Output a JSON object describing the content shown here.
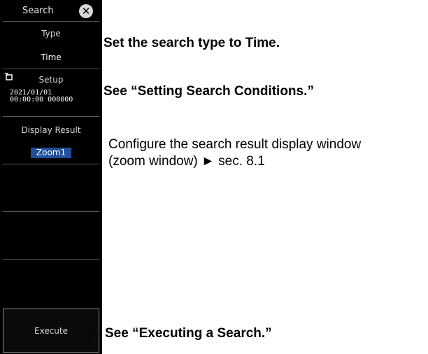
{
  "panel": {
    "header": {
      "title": "Search",
      "close_icon": "close-icon"
    },
    "type": {
      "label": "Type",
      "value": "Time"
    },
    "setup": {
      "label": "Setup",
      "icon": "setup-icon",
      "date": "2021/01/01",
      "time": "00:00:00 000000"
    },
    "display_result": {
      "label": "Display Result",
      "value": "Zoom1",
      "highlight_color": "#1f4f9a"
    },
    "execute": {
      "label": "Execute"
    }
  },
  "callouts": {
    "type": "Set the search type to Time.",
    "setup": "See “Setting Search Conditions.”",
    "display_line1": "Configure the search result display window",
    "display_line2": "(zoom window) ► sec. 8.1",
    "execute": "See “Executing a Search.”"
  }
}
